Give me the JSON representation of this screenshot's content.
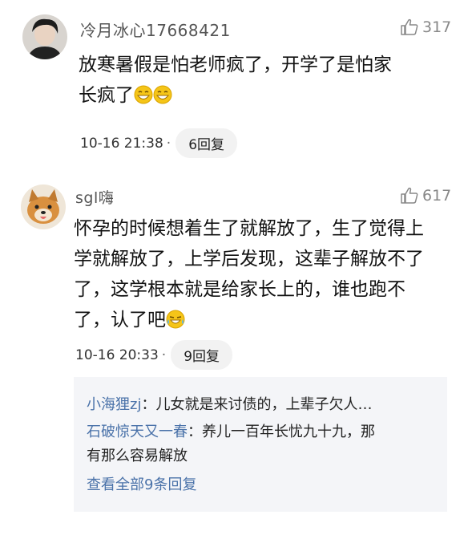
{
  "comments": [
    {
      "username": "冷月冰心17668421",
      "likes": "317",
      "text_lines": [
        "放寒暑假是怕老师疯了，开学了是怕家",
        "长疯了"
      ],
      "emojis": [
        "grin-emoji",
        "grin-emoji"
      ],
      "time": "10-16 21:38",
      "reply_label": "6回复"
    },
    {
      "username": "sgl嗨",
      "likes": "617",
      "text_lines": [
        "怀孕的时候想着生了就解放了，生了觉得上",
        "学就解放了，上学后发现，这辈子解放不了",
        "了，这学根本就是给家长上的，谁也跑不",
        "了，认了吧"
      ],
      "emojis": [
        "laugh-cry-emoji"
      ],
      "time": "10-16 20:33",
      "reply_label": "9回复",
      "replies": [
        {
          "name": "小海狸zj",
          "text": "：儿女就是来讨债的，上辈子欠人…"
        },
        {
          "name": "石破惊天又一春",
          "text": "：养儿一百年长忧九十九，那",
          "text2": "有那么容易解放"
        }
      ],
      "see_all": "查看全部9条回复"
    }
  ],
  "colors": {
    "link_blue": "#4a72a9",
    "reply_bg": "#f4f5f8",
    "pill_bg": "#f2f2f2"
  }
}
